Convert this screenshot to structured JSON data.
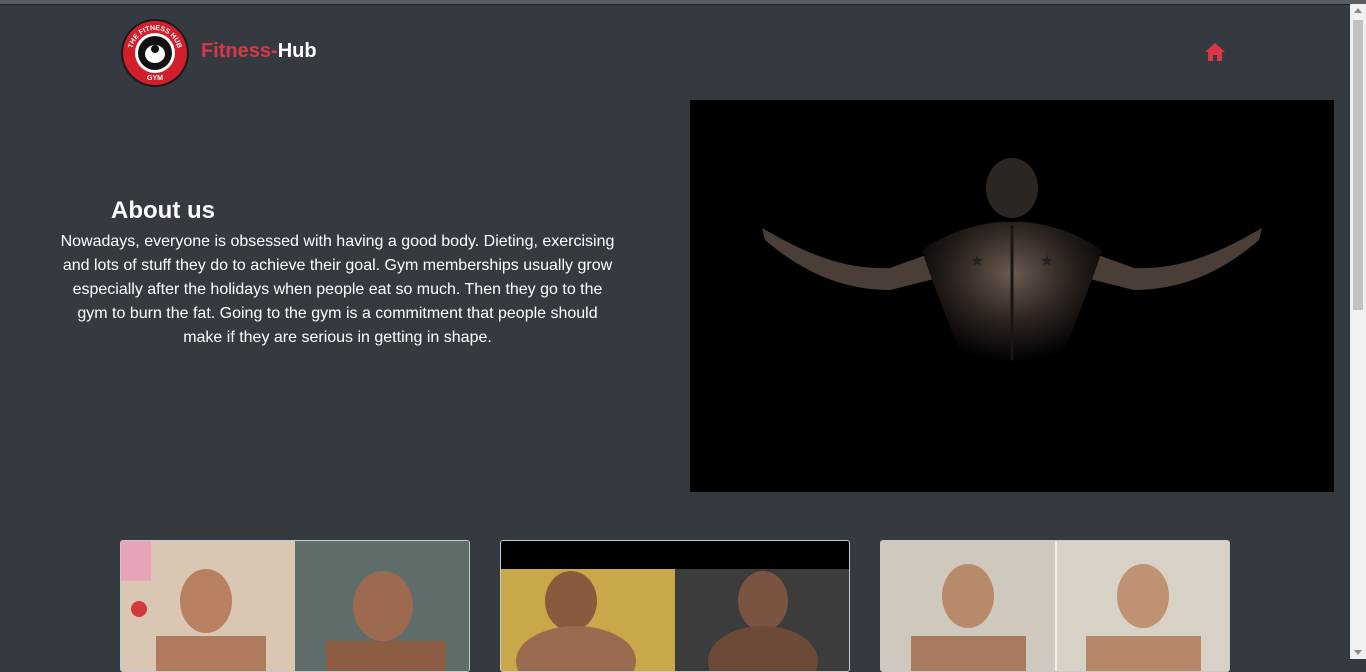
{
  "header": {
    "brand_prefix": "Fitness-",
    "brand_suffix": "Hub",
    "logo_text_top": "THE FITNESS HUB",
    "logo_text_bottom": "GYM"
  },
  "nav": {
    "home_icon": "home-icon"
  },
  "about": {
    "title": "About us",
    "body": "Nowadays, everyone is obsessed with having a good body. Dieting, exercising and lots of stuff they do to achieve their goal. Gym memberships usually grow especially after the holidays when people eat so much. Then they go to the gym to burn the fat. Going to the gym is a commitment that people should make if they are serious in getting in shape."
  },
  "colors": {
    "background": "#343a40",
    "accent": "#dc3545",
    "text": "#ffffff"
  }
}
